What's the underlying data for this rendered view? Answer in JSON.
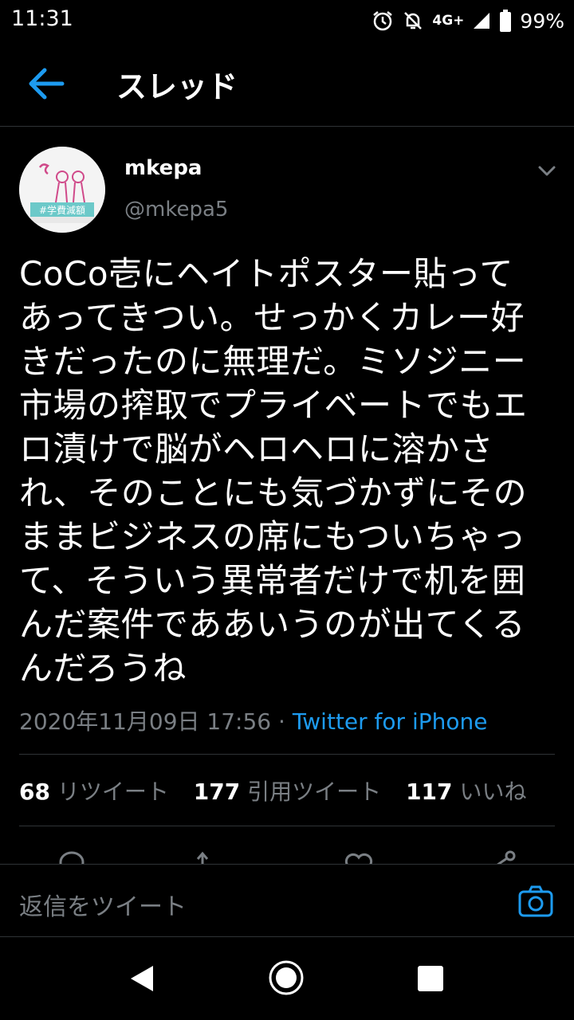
{
  "status_bar": {
    "time": "11:31",
    "network": "4G+",
    "battery": "99%"
  },
  "header": {
    "title": "スレッド"
  },
  "tweet": {
    "author_name": "mkepa",
    "author_handle": "@mkepa5",
    "avatar_text": "#学費減額",
    "text": "CoCo壱にヘイトポスター貼って\nあってきつい。せっかくカレー好\nきだったのに無理だ。ミソジニー\n市場の搾取でプライベートでもエ\nロ漬けで脳がヘロヘロに溶かさ\nれ、そのことにも気づかずにその\nままビジネスの席にもついちゃっ\nて、そういう異常者だけで机を囲\nんだ案件でああいうのが出てくる\nんだろうね",
    "timestamp": "2020年11月09日 17:56",
    "separator": " · ",
    "source": "Twitter for iPhone"
  },
  "stats": {
    "retweets_count": "68",
    "retweets_label": "リツイート",
    "quotes_count": "177",
    "quotes_label": "引用ツイート",
    "likes_count": "117",
    "likes_label": "いいね"
  },
  "reply": {
    "placeholder": "返信をツイート"
  },
  "colors": {
    "background": "#000000",
    "accent": "#1d9bf0",
    "secondary_text": "#7a7f84",
    "divider": "#2f3336"
  }
}
